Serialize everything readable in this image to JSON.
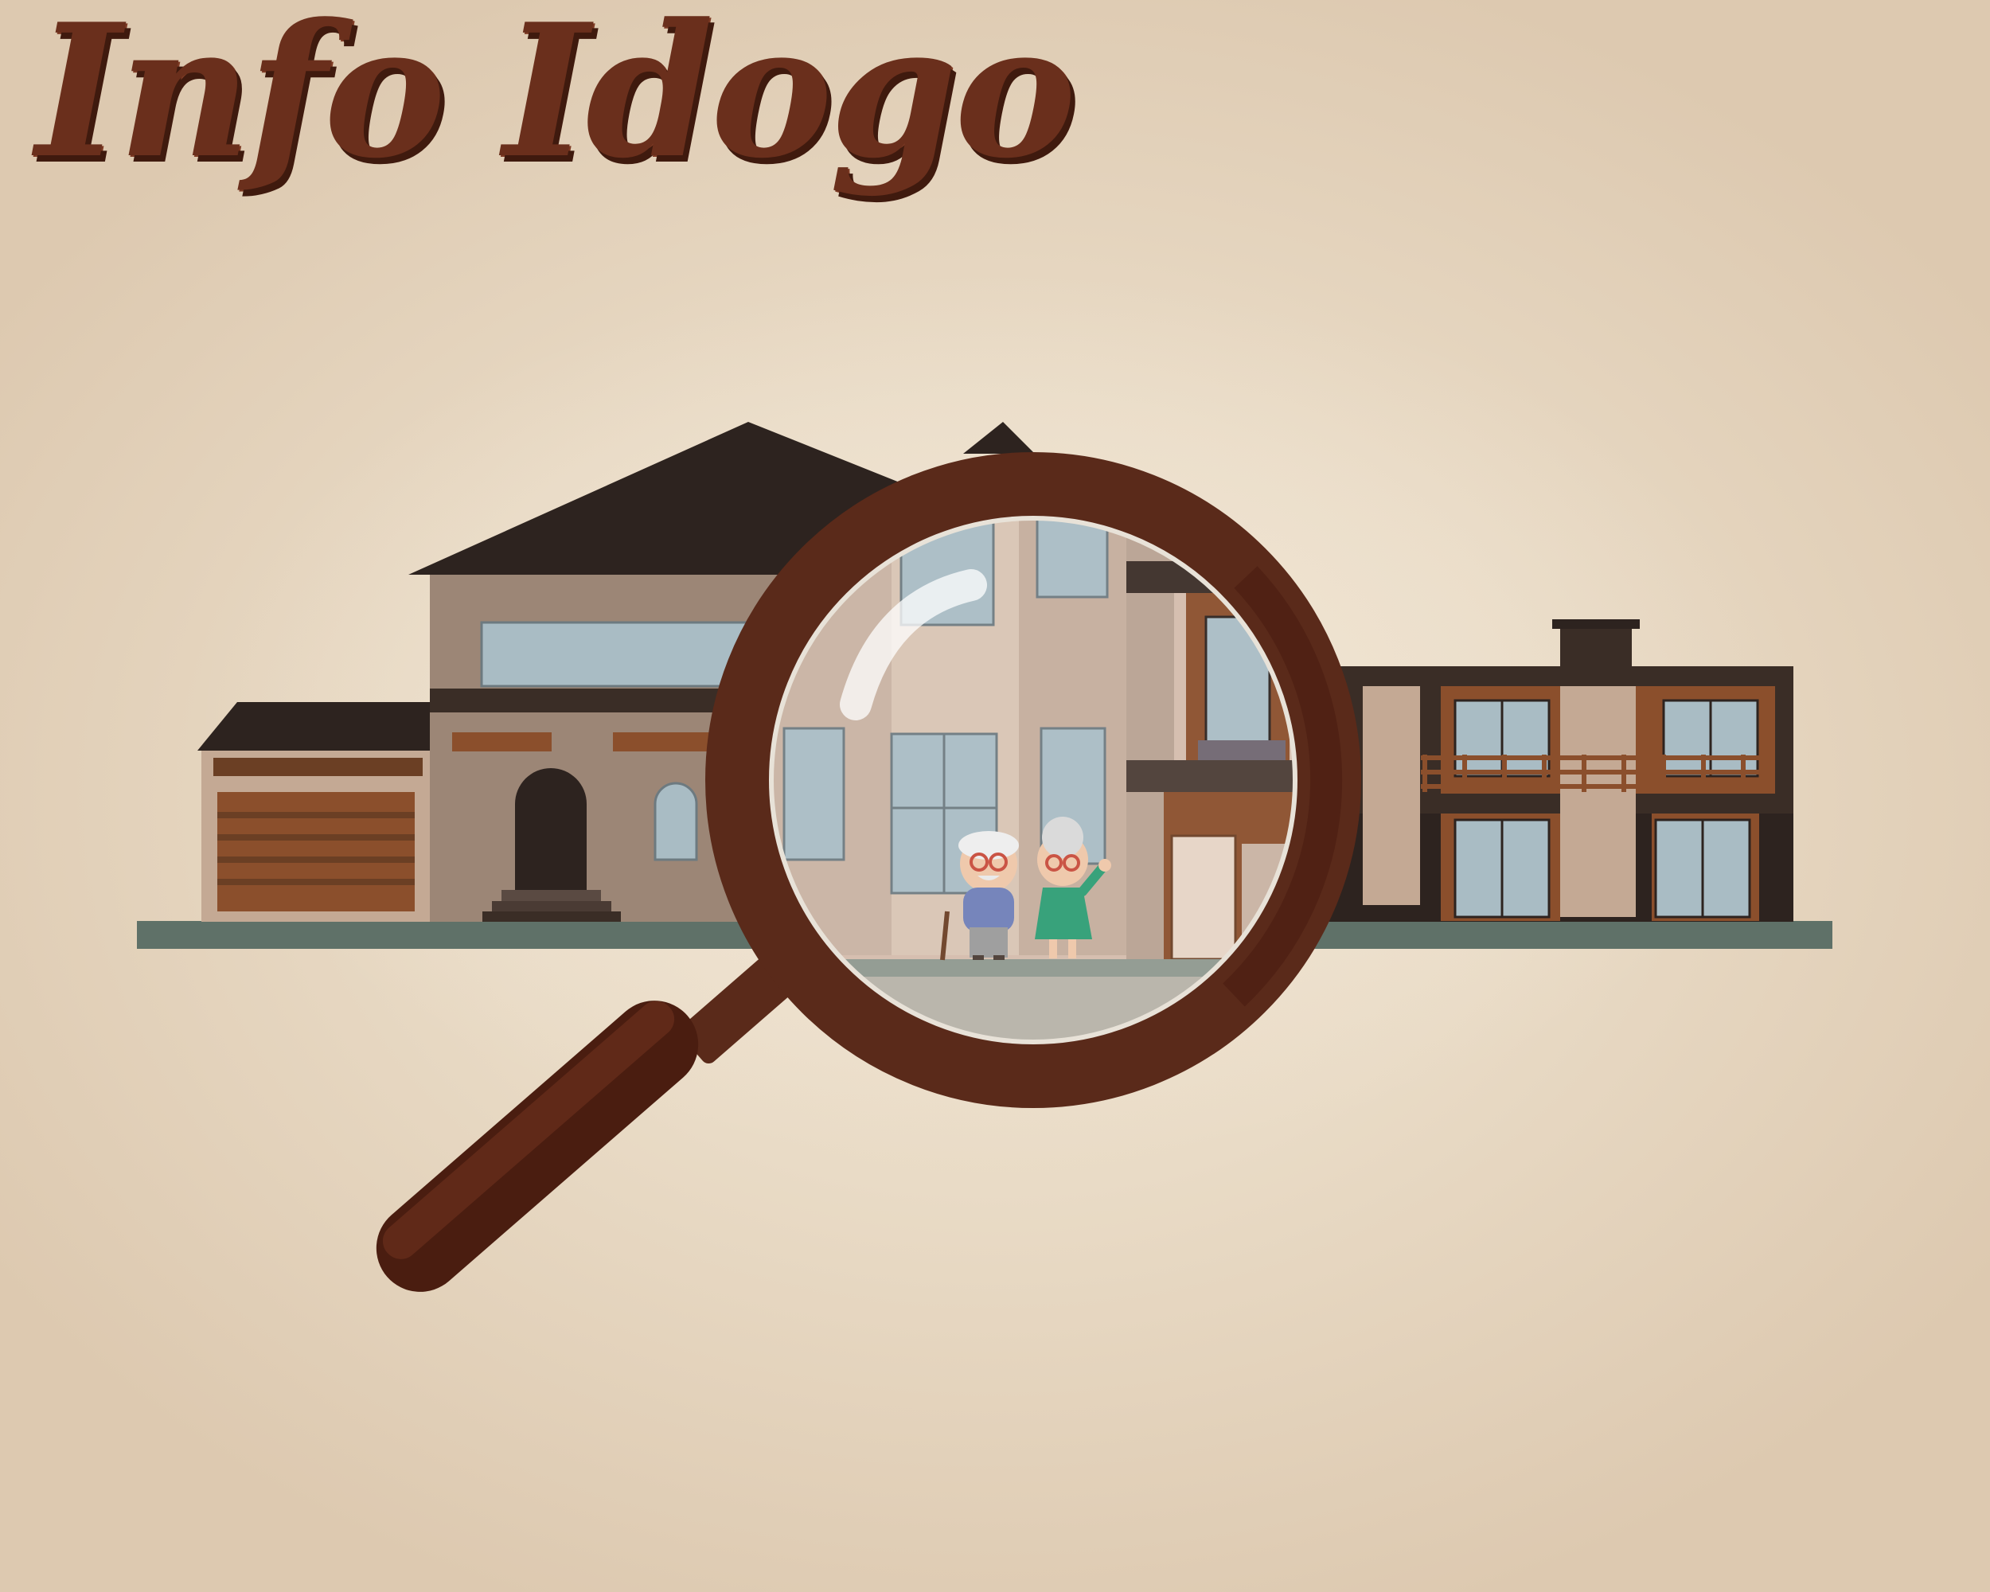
{
  "title": "Info Idogo",
  "colors": {
    "title": "#6a2f1c",
    "title_shadow": "#3f1a0e",
    "roof": "#2d231f",
    "wall_main": "#9c8676",
    "wall_light": "#c9b3a3",
    "wood": "#8b4f2c",
    "glass": "#a9bcc4",
    "ground": "#5f7168",
    "magnifier_ring": "#5a2a1a",
    "magnifier_handle": "#4a1d10"
  },
  "icons": {
    "magnifier": "magnifying-glass-icon",
    "house": "house-icon",
    "elderly_couple": "elderly-couple-icon"
  }
}
